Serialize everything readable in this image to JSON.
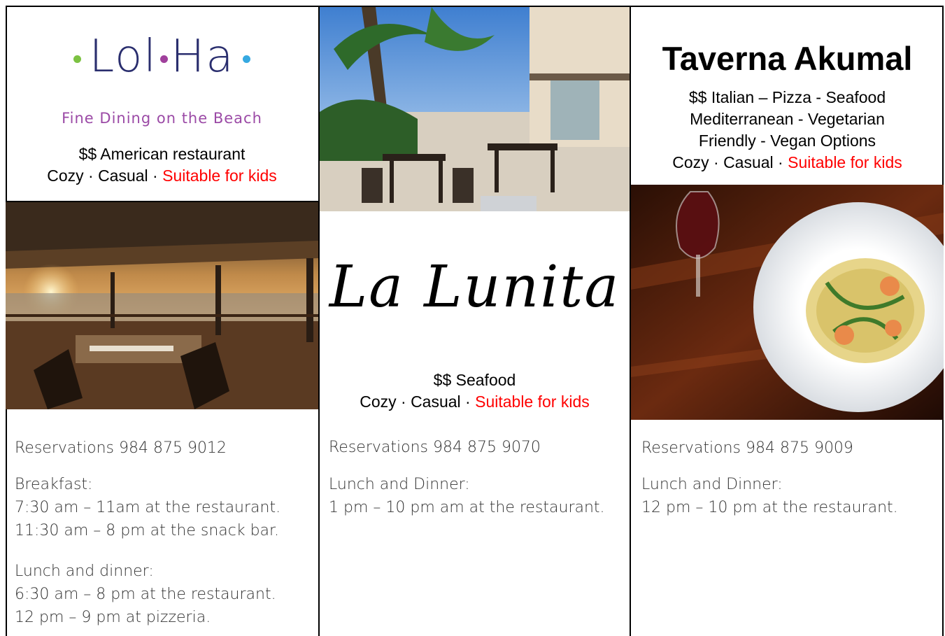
{
  "colors": {
    "accent_red": "#ff0000",
    "lolha_navy": "#2a2e6e",
    "lolha_purple": "#9b4aa6",
    "dot_green": "#7cc242",
    "dot_purple": "#a0409c",
    "dot_blue": "#36a9e1"
  },
  "lolha": {
    "logo": "Lol·Ha",
    "tagline": "Fine Dining on the Beach",
    "price_type": "$$  American restaurant",
    "attrs": "Cozy · Casual · ",
    "kids": "Suitable for kids",
    "reservations": "Reservations 984 875 9012",
    "breakfast_label": "Breakfast:",
    "breakfast_1": "7:30 am – 11am at the restaurant.",
    "breakfast_2": "11:30 am – 8 pm at the snack bar.",
    "lunch_label": "Lunch and dinner:",
    "lunch_1": "6:30 am – 8 pm at the restaurant.",
    "lunch_2": "12 pm – 9 pm at pizzeria."
  },
  "lunita": {
    "logo": "La Lunita",
    "price_type": "$$  Seafood",
    "attrs": "Cozy · Casual · ",
    "kids": "Suitable for kids",
    "reservations": "Reservations 984 875 9070",
    "hours_label": "Lunch and Dinner:",
    "hours_1": "1 pm – 10 pm am at the restaurant."
  },
  "taverna": {
    "title": "Taverna Akumal",
    "line1": "$$ Italian – Pizza - Seafood",
    "line2": "Mediterranean - Vegetarian",
    "line3": "Friendly - Vegan Options",
    "attrs": "Cozy · Casual · ",
    "kids": "Suitable for kids",
    "reservations": "Reservations 984 875 9009",
    "hours_label": "Lunch and Dinner:",
    "hours_1": "12 pm – 10 pm at the restaurant."
  }
}
